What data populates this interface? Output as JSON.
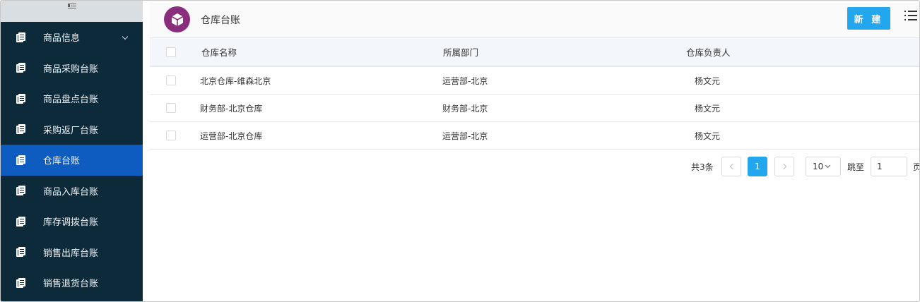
{
  "page": {
    "title": "仓库台账",
    "new_button": "新 建"
  },
  "sidebar": {
    "items": [
      {
        "label": "商品信息",
        "has_submenu": true,
        "active": false
      },
      {
        "label": "商品采购台账",
        "active": false
      },
      {
        "label": "商品盘点台账",
        "active": false
      },
      {
        "label": "采购返厂台账",
        "active": false
      },
      {
        "label": "仓库台账",
        "active": true
      },
      {
        "label": "商品入库台账",
        "active": false
      },
      {
        "label": "库存调拨台账",
        "active": false
      },
      {
        "label": "销售出库台账",
        "active": false
      },
      {
        "label": "销售退货台账",
        "active": false
      }
    ]
  },
  "table": {
    "columns": [
      "仓库名称",
      "所属部门",
      "仓库负责人"
    ],
    "rows": [
      [
        "北京仓库-维森北京",
        "运营部-北京",
        "杨文元"
      ],
      [
        "财务部-北京仓库",
        "财务部-北京",
        "杨文元"
      ],
      [
        "运营部-北京仓库",
        "运营部-北京",
        "杨文元"
      ]
    ]
  },
  "pagination": {
    "total_label": "共3条",
    "current_page": "1",
    "page_size": "10",
    "jump_label": "跳至",
    "jump_value": "1",
    "page_suffix": "页"
  },
  "colors": {
    "sidebar_bg": "#0c2a3a",
    "active_item": "#0e5cc0",
    "primary": "#22a7ef",
    "logo": "#8a2d7c"
  }
}
